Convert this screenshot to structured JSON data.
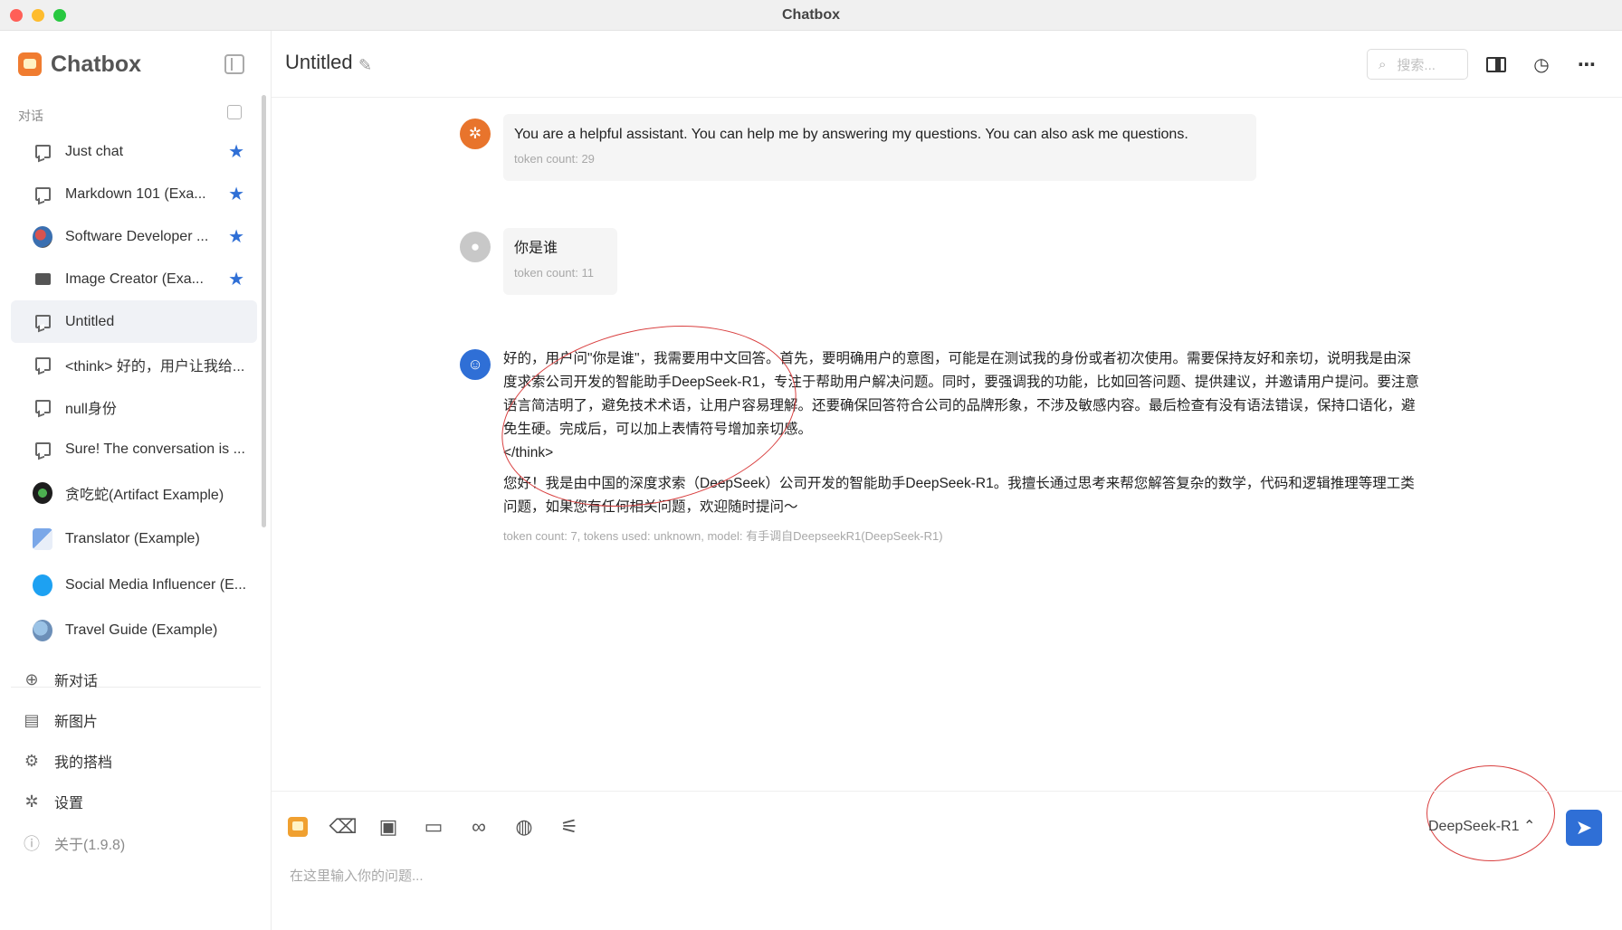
{
  "window": {
    "title": "Chatbox"
  },
  "sidebar": {
    "brand": "Chatbox",
    "section_label": "对话",
    "conversations": [
      {
        "label": "Just chat",
        "icon": "chat-icon",
        "starred": true
      },
      {
        "label": "Markdown 101 (Exa...",
        "icon": "chat-icon",
        "starred": true
      },
      {
        "label": "Software Developer ...",
        "icon": "developer-avatar-icon",
        "starred": true
      },
      {
        "label": "Image Creator (Exa...",
        "icon": "image-icon",
        "starred": true
      },
      {
        "label": "Untitled",
        "icon": "chat-icon",
        "starred": false,
        "selected": true
      },
      {
        "label": "<think> 好的，用户让我给...",
        "icon": "chat-icon",
        "starred": false
      },
      {
        "label": "null身份",
        "icon": "chat-icon",
        "starred": false
      },
      {
        "label": "Sure! The conversation is ...",
        "icon": "chat-icon",
        "starred": false
      },
      {
        "label": "贪吃蛇(Artifact Example)",
        "icon": "snake-avatar-icon",
        "starred": false
      },
      {
        "label": "Translator (Example)",
        "icon": "translator-avatar-icon",
        "starred": false
      },
      {
        "label": "Social Media Influencer (E...",
        "icon": "twitter-avatar-icon",
        "starred": false
      },
      {
        "label": "Travel Guide (Example)",
        "icon": "globe-avatar-icon",
        "starred": false
      }
    ],
    "menu": {
      "new_chat": "新对话",
      "new_image": "新图片",
      "my_copilots": "我的搭档",
      "settings": "设置",
      "about": "关于(1.9.8)"
    }
  },
  "header": {
    "title": "Untitled",
    "search_placeholder": "搜索..."
  },
  "messages": {
    "system": {
      "text": "You are a helpful assistant. You can help me by answering my questions. You can also ask me questions.",
      "meta": "token count: 29"
    },
    "user": {
      "text": "你是谁",
      "meta": "token count: 11"
    },
    "assistant": {
      "think": "好的，用户问\"你是谁\"，我需要用中文回答。首先，要明确用户的意图，可能是在测试我的身份或者初次使用。需要保持友好和亲切，说明我是由深度求索公司开发的智能助手DeepSeek-R1，专注于帮助用户解决问题。同时，要强调我的功能，比如回答问题、提供建议，并邀请用户提问。要注意语言简洁明了，避免技术术语，让用户容易理解。还要确保回答符合公司的品牌形象，不涉及敏感内容。最后检查有没有语法错误，保持口语化，避免生硬。完成后，可以加上表情符号增加亲切感。",
      "think_close": "</think>",
      "answer": "您好！我是由中国的深度求索（DeepSeek）公司开发的智能助手DeepSeek-R1。我擅长通过思考来帮您解答复杂的数学，代码和逻辑推理等理工类问题，如果您有任何相关问题，欢迎随时提问～",
      "meta": "token count: 7, tokens used: unknown, model: 有手调自DeepseekR1(DeepSeek-R1)"
    }
  },
  "composer": {
    "placeholder": "在这里输入你的问题...",
    "model": "DeepSeek-R1 ⌃"
  },
  "colors": {
    "accent": "#2f6fd6",
    "system_avatar": "#e8742c",
    "annotation": "#d94040"
  }
}
